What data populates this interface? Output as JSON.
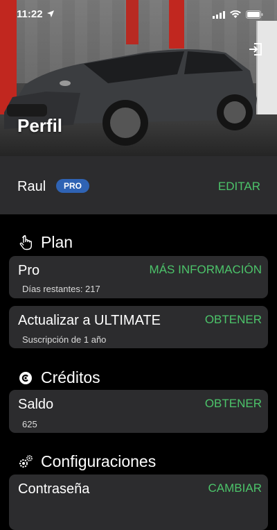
{
  "status_bar": {
    "time": "11:22"
  },
  "hero": {
    "title": "Perfil"
  },
  "profile": {
    "name": "Raul",
    "badge": "PRO",
    "edit_label": "EDITAR"
  },
  "sections": {
    "plan": {
      "heading": "Plan"
    },
    "credits": {
      "heading": "Créditos"
    },
    "settings": {
      "heading": "Configuraciones"
    }
  },
  "cards": {
    "pro": {
      "title": "Pro",
      "action": "MÁS INFORMACIÓN",
      "sub": "Días restantes: 217"
    },
    "upgrade": {
      "title": "Actualizar a ULTIMATE",
      "action": "OBTENER",
      "sub": "Suscripción de 1 año"
    },
    "balance": {
      "title": "Saldo",
      "action": "OBTENER",
      "sub": "625"
    },
    "password": {
      "title": "Contraseña",
      "action": "CAMBIAR"
    }
  },
  "colors": {
    "accent": "#4cc46a",
    "badge": "#2f63b4",
    "card": "#2c2c2e"
  },
  "icons": [
    "location-arrow-icon",
    "signal-icon",
    "wifi-icon",
    "battery-icon",
    "exit-icon",
    "hand-pointer-icon",
    "credit-coin-icon",
    "gears-icon"
  ]
}
